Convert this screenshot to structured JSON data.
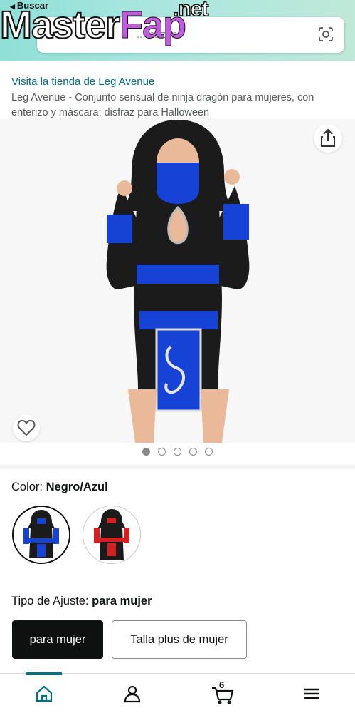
{
  "header": {
    "back_label": "Buscar",
    "search_placeholder": "...mazon",
    "colors": {
      "gradient_start": "#8fe0d8",
      "gradient_end": "#bfe9d9"
    }
  },
  "watermark": {
    "part1": "Master",
    "part2": "Fap",
    "part3": ".net"
  },
  "store": {
    "link_text": "Visita la tienda de Leg Avenue"
  },
  "product": {
    "title": "Leg Avenue - Conjunto sensual de ninja dragón para mujeres, con enterizo y máscara; disfraz para Halloween"
  },
  "image_pager": {
    "count": 5,
    "active_index": 0
  },
  "color": {
    "label": "Color:",
    "selected": "Negro/Azul",
    "options": [
      "Negro/Azul",
      "Negro/Rojo"
    ]
  },
  "fit": {
    "label": "Tipo de Ajuste:",
    "selected": "para mujer",
    "options": [
      "para mujer",
      "Talla plus de mujer"
    ]
  },
  "bottom_nav": {
    "items": [
      "home-icon",
      "account-icon",
      "cart-icon",
      "menu-icon"
    ],
    "cart_count": "6",
    "active": "home-icon"
  },
  "accent": "#007185",
  "link_color": "#007185"
}
